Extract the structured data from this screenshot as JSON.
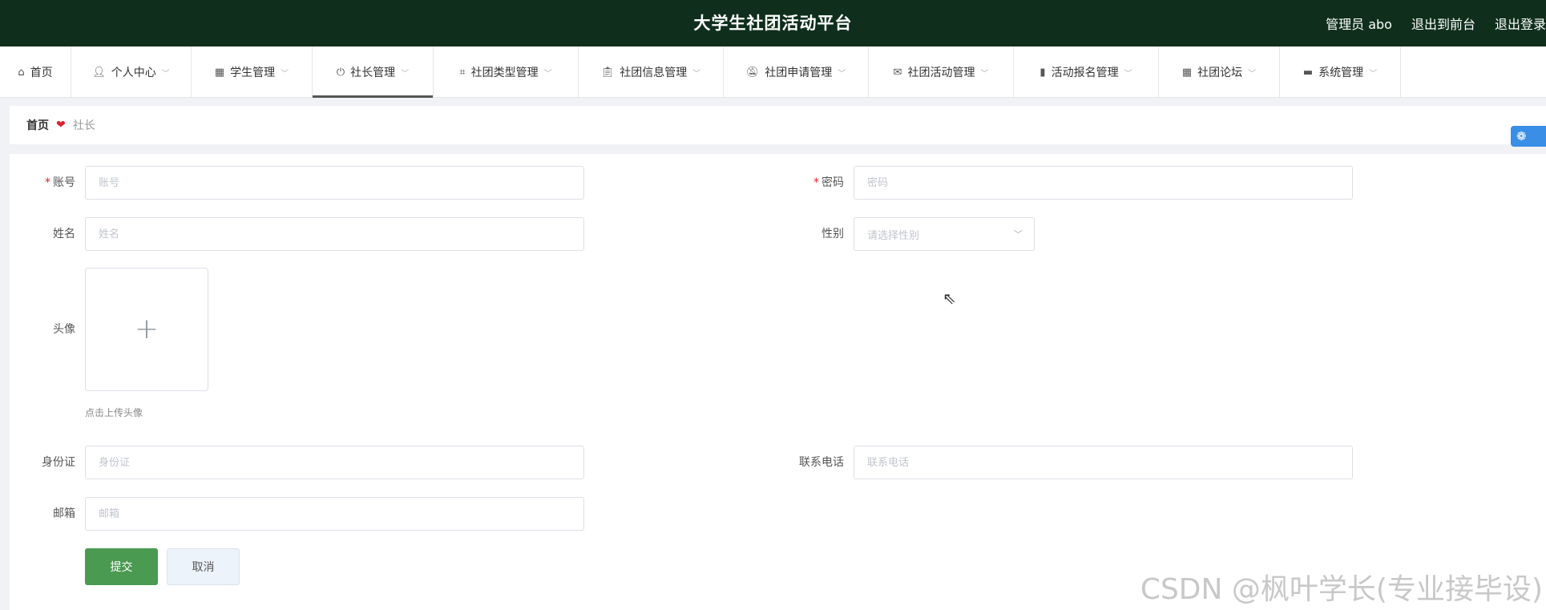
{
  "header": {
    "title": "大学生社团活动平台",
    "user": "管理员 abo",
    "exit_front": "退出到前台",
    "logout": "退出登录"
  },
  "nav": {
    "items": [
      {
        "label": "首页",
        "icon": "home-icon",
        "has_dropdown": false,
        "active": false
      },
      {
        "label": "个人中心",
        "icon": "user-icon",
        "has_dropdown": true,
        "active": false
      },
      {
        "label": "学生管理",
        "icon": "grid-icon",
        "has_dropdown": true,
        "active": false
      },
      {
        "label": "社长管理",
        "icon": "power-icon",
        "has_dropdown": true,
        "active": true
      },
      {
        "label": "社团类型管理",
        "icon": "crop-icon",
        "has_dropdown": true,
        "active": false
      },
      {
        "label": "社团信息管理",
        "icon": "clipboard-icon",
        "has_dropdown": true,
        "active": false
      },
      {
        "label": "社团申请管理",
        "icon": "bell-off-icon",
        "has_dropdown": true,
        "active": false
      },
      {
        "label": "社团活动管理",
        "icon": "mail-icon",
        "has_dropdown": true,
        "active": false
      },
      {
        "label": "活动报名管理",
        "icon": "bar-chart-icon",
        "has_dropdown": true,
        "active": false
      },
      {
        "label": "社团论坛",
        "icon": "table-icon",
        "has_dropdown": true,
        "active": false
      },
      {
        "label": "系统管理",
        "icon": "monitor-icon",
        "has_dropdown": true,
        "active": false
      }
    ]
  },
  "breadcrumb": {
    "home": "首页",
    "current": "社长"
  },
  "form": {
    "account": {
      "label": "账号",
      "placeholder": "账号",
      "value": "",
      "required": true
    },
    "password": {
      "label": "密码",
      "placeholder": "密码",
      "value": "",
      "required": true
    },
    "name": {
      "label": "姓名",
      "placeholder": "姓名",
      "value": ""
    },
    "gender": {
      "label": "性别",
      "placeholder": "请选择性别",
      "value": ""
    },
    "avatar": {
      "label": "头像",
      "hint": "点击上传头像"
    },
    "id_card": {
      "label": "身份证",
      "placeholder": "身份证",
      "value": ""
    },
    "phone": {
      "label": "联系电话",
      "placeholder": "联系电话",
      "value": ""
    },
    "email": {
      "label": "邮箱",
      "placeholder": "邮箱",
      "value": ""
    },
    "submit_label": "提交",
    "cancel_label": "取消"
  },
  "watermark": "CSDN @枫叶学长(专业接毕设)",
  "colors": {
    "header_bg": "#0f2f1c",
    "submit_bg": "#4a9a52",
    "required_star": "#e0212b",
    "breadcrumb_heart": "#e0212b"
  }
}
